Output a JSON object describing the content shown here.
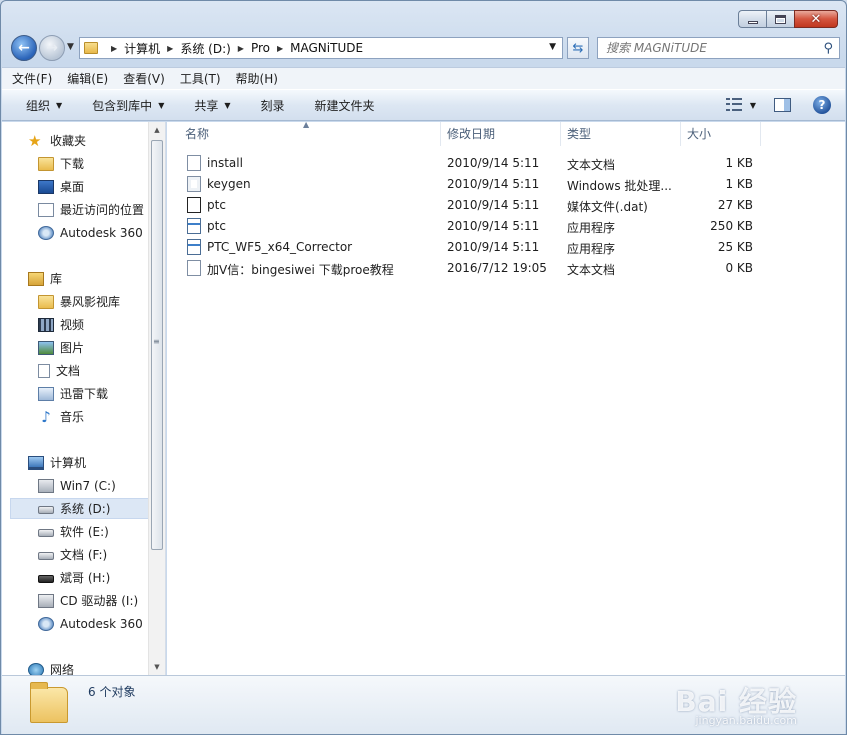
{
  "address": {
    "crumbs": [
      "计算机",
      "系统 (D:)",
      "Pro",
      "MAGNiTUDE"
    ]
  },
  "search": {
    "placeholder": "搜索 MAGNiTUDE"
  },
  "menu": [
    "文件(F)",
    "编辑(E)",
    "查看(V)",
    "工具(T)",
    "帮助(H)"
  ],
  "commands": {
    "organize": "组织",
    "include_library": "包含到库中",
    "share": "共享",
    "burn": "刻录",
    "new_folder": "新建文件夹"
  },
  "nav": {
    "favorites": {
      "header": "收藏夹",
      "items": [
        "下载",
        "桌面",
        "最近访问的位置",
        "Autodesk 360"
      ]
    },
    "libraries": {
      "header": "库",
      "items": [
        "暴风影视库",
        "视频",
        "图片",
        "文档",
        "迅雷下载",
        "音乐"
      ]
    },
    "computer": {
      "header": "计算机",
      "items": [
        "Win7 (C:)",
        "系统 (D:)",
        "软件 (E:)",
        "文档 (F:)",
        "斌哥 (H:)",
        "CD 驱动器 (I:)",
        "Autodesk 360"
      ]
    },
    "network": {
      "header": "网络"
    }
  },
  "columns": {
    "name": "名称",
    "modified": "修改日期",
    "type": "类型",
    "size": "大小"
  },
  "files": [
    {
      "name": "install",
      "modified": "2010/9/14 5:11",
      "type": "文本文档",
      "size": "1 KB",
      "icon": "text-file-icon"
    },
    {
      "name": "keygen",
      "modified": "2010/9/14 5:11",
      "type": "Windows 批处理...",
      "size": "1 KB",
      "icon": "batch-file-icon"
    },
    {
      "name": "ptc",
      "modified": "2010/9/14 5:11",
      "type": "媒体文件(.dat)",
      "size": "27 KB",
      "icon": "dat-file-icon"
    },
    {
      "name": "ptc",
      "modified": "2010/9/14 5:11",
      "type": "应用程序",
      "size": "250 KB",
      "icon": "exe-file-icon"
    },
    {
      "name": "PTC_WF5_x64_Corrector",
      "modified": "2010/9/14 5:11",
      "type": "应用程序",
      "size": "25 KB",
      "icon": "exe-file-icon"
    },
    {
      "name": "加V信：bingesiwei  下载proe教程",
      "modified": "2016/7/12 19:05",
      "type": "文本文档",
      "size": "0 KB",
      "icon": "text-file-icon"
    }
  ],
  "status": {
    "count": "6 个对象"
  },
  "watermark": {
    "brand": "Bai 经验",
    "url": "jingyan.baidu.com"
  }
}
